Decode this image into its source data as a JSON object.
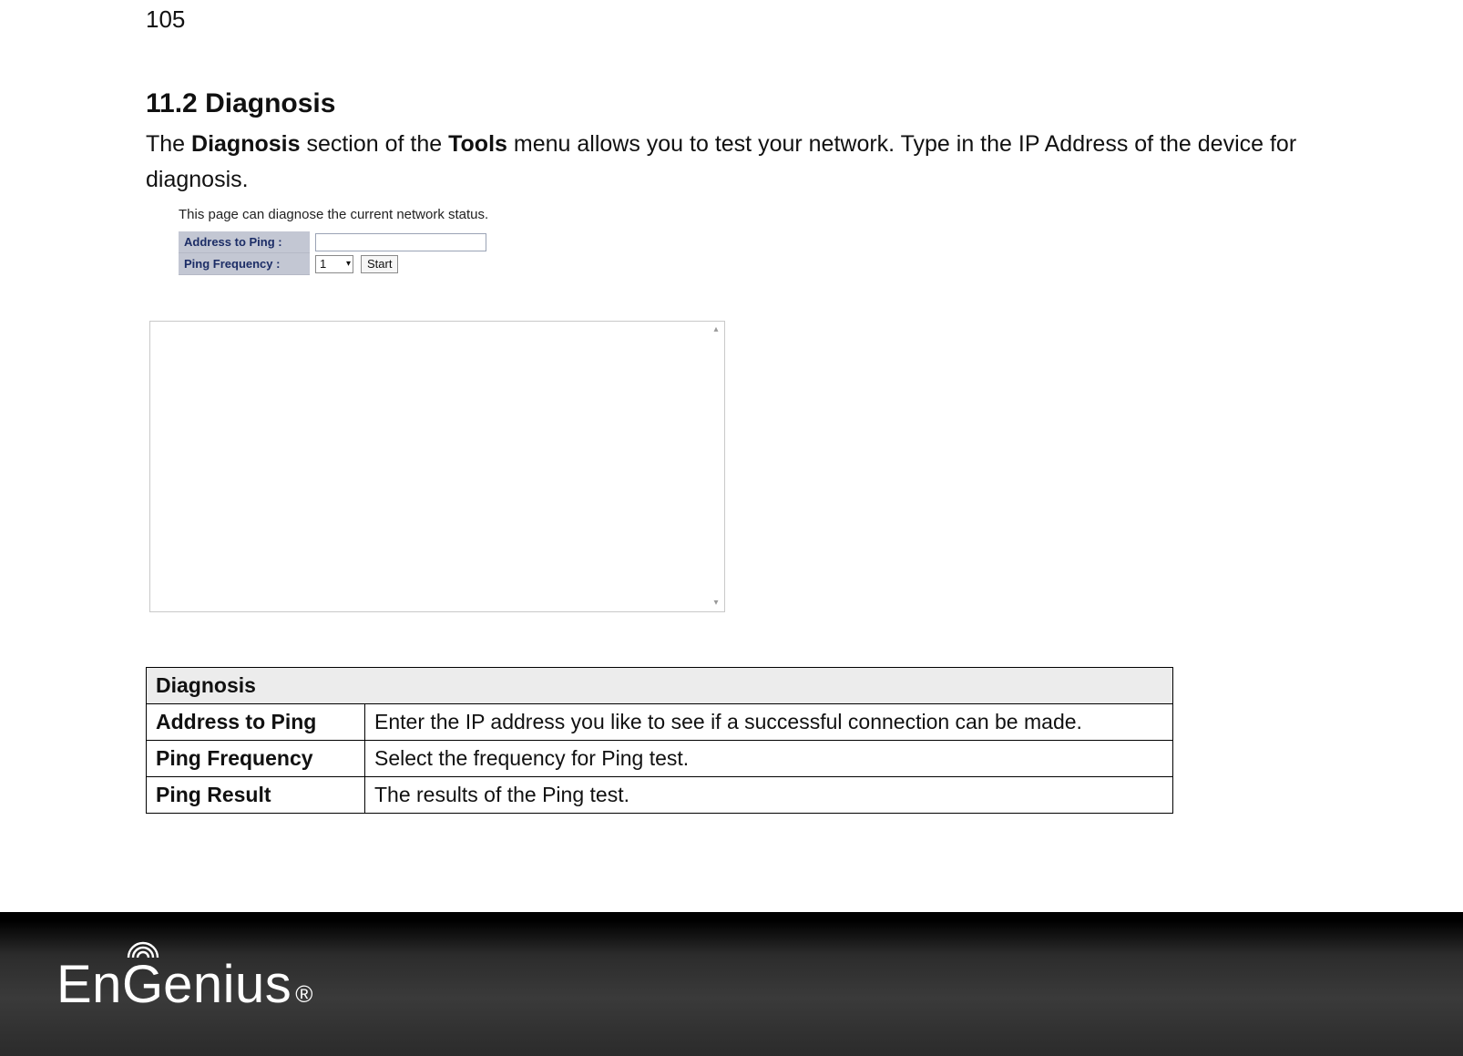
{
  "page_number": "105",
  "section_title": "11.2 Diagnosis",
  "intro_prefix": "The ",
  "intro_b1": "Diagnosis",
  "intro_mid": " section of the ",
  "intro_b2": "Tools",
  "intro_suffix": " menu allows you to test your network. Type in the IP Address of the device for diagnosis.",
  "shot": {
    "note": "This page can diagnose the current network status.",
    "row1_label": "Address to Ping :",
    "row2_label": "Ping Frequency :",
    "address_value": "",
    "freq_value": "1",
    "start_label": "Start"
  },
  "def_table": {
    "header": "Diagnosis",
    "rows": [
      {
        "label": "Address to Ping",
        "desc": "Enter the IP address you like to see if a successful connection can be made."
      },
      {
        "label": "Ping Frequency",
        "desc": "Select the frequency for Ping test."
      },
      {
        "label": "Ping Result",
        "desc": "The results of the Ping test."
      }
    ]
  },
  "logo": {
    "part1": "En",
    "part2": "G",
    "part3": "enius",
    "reg": "®"
  }
}
